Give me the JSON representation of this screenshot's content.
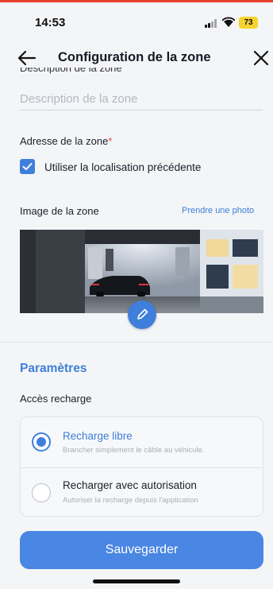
{
  "status": {
    "time": "14:53",
    "battery": "73"
  },
  "header": {
    "title": "Configuration de la zone",
    "back_icon": "arrow-left-icon",
    "close_icon": "close-icon"
  },
  "form": {
    "cut_label": "Description de la zone",
    "description_placeholder": "Description de la zone",
    "address_label": "Adresse de la zone",
    "address_required": "*",
    "use_previous_location": "Utiliser la localisation précédente",
    "use_previous_location_checked": true,
    "image_label": "Image de la zone",
    "take_photo": "Prendre une photo"
  },
  "parameters": {
    "title": "Paramètres",
    "access_label": "Accès recharge",
    "options": [
      {
        "title": "Recharge libre",
        "description": "Brancher simplement le câble au véhicule.",
        "selected": true
      },
      {
        "title": "Recharger avec autorisation",
        "description": "Autoriser la recharge depuis l'application",
        "selected": false
      }
    ]
  },
  "actions": {
    "save_label": "Sauvegarder"
  },
  "colors": {
    "accent": "#3f7fdc",
    "required": "#e24b4b",
    "battery": "#f6d32d",
    "top_strip": "#e8412b"
  }
}
